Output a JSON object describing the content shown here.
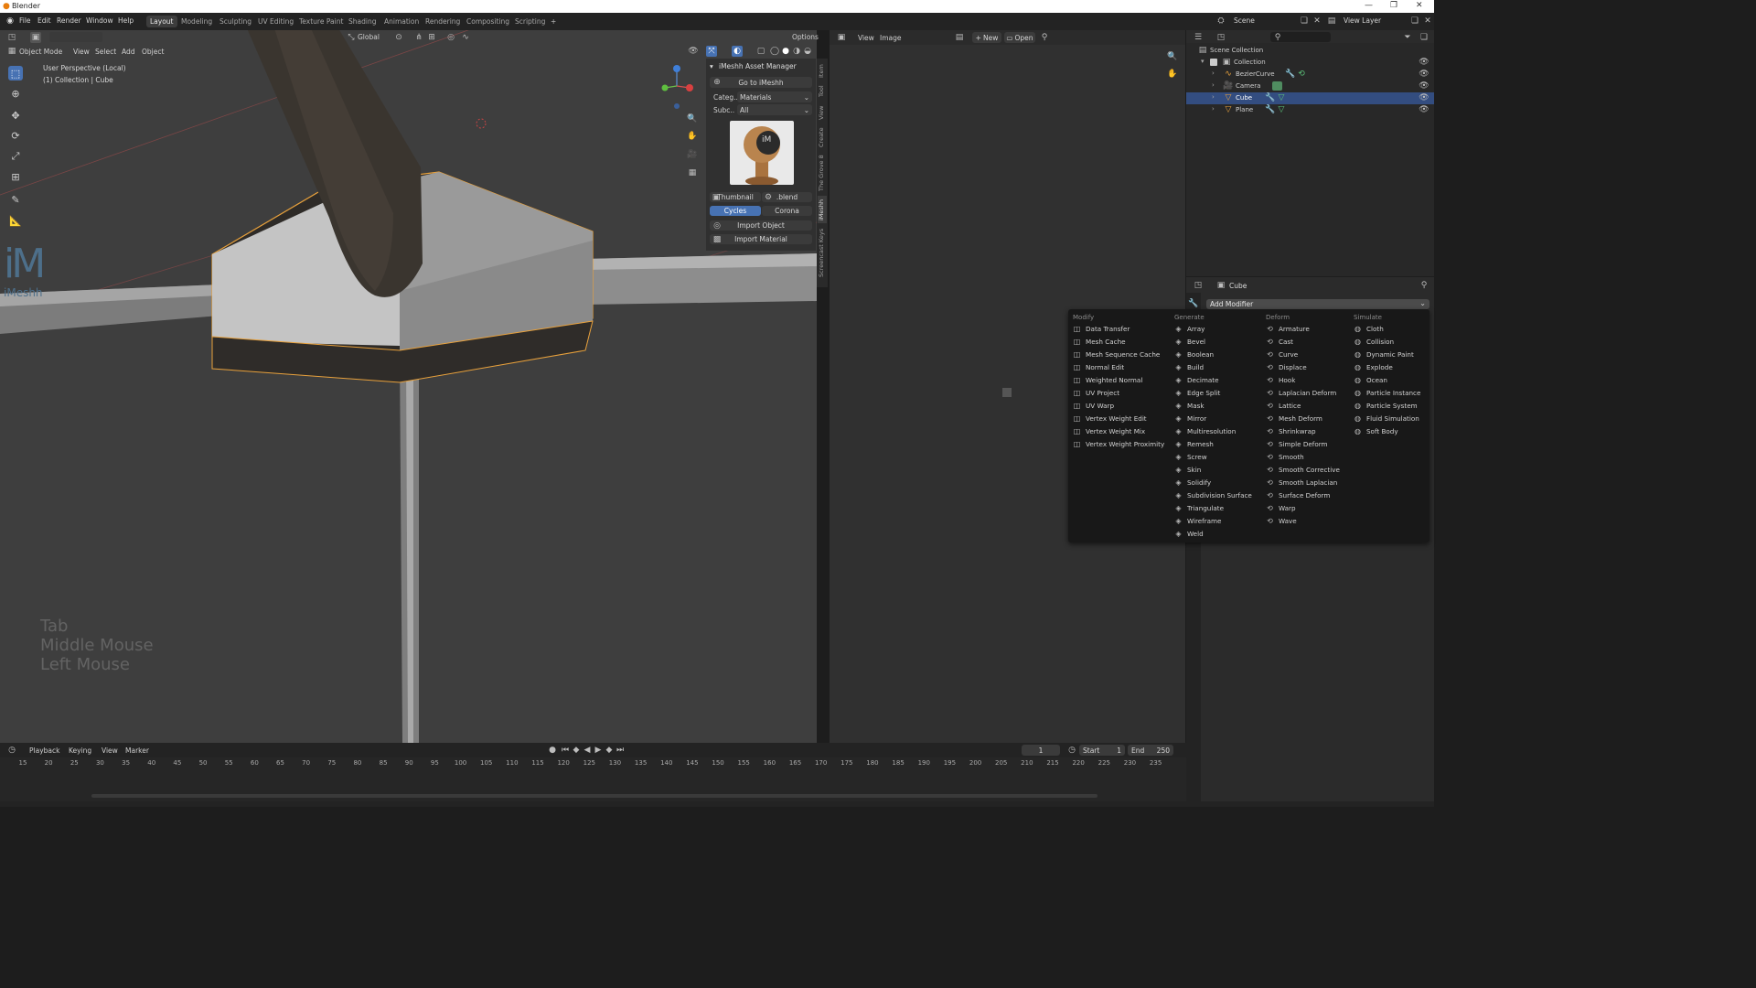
{
  "window": {
    "title": "Blender"
  },
  "menu": [
    "File",
    "Edit",
    "Render",
    "Window",
    "Help"
  ],
  "workspaces": [
    "Layout",
    "Modeling",
    "Sculpting",
    "UV Editing",
    "Texture Paint",
    "Shading",
    "Animation",
    "Rendering",
    "Compositing",
    "Scripting"
  ],
  "active_workspace": "Layout",
  "scene": {
    "name": "Scene",
    "view_layer": "View Layer"
  },
  "viewport": {
    "mode": "Object Mode",
    "menus": [
      "View",
      "Select",
      "Add",
      "Object"
    ],
    "transform_orientation": "Global",
    "options_label": "Options",
    "info_line1": "User Perspective (Local)",
    "info_line2": "(1) Collection | Cube",
    "watermark_text": "iMeshh",
    "key_hints": [
      "Tab",
      "Middle Mouse",
      "Left Mouse"
    ]
  },
  "npanel": {
    "header": "iMeshh Asset Manager",
    "go_button": "Go to iMeshh",
    "category_label": "Categ..",
    "category_value": "Materials",
    "subcategory_label": "Subc..",
    "subcategory_value": "All",
    "thumb_logo": "iM",
    "thumbnail_label": "Thumbnail",
    "blend_label": ".blend",
    "engine_cycles": "Cycles",
    "engine_corona": "Corona",
    "import_object": "Import Object",
    "import_material": "Import Material",
    "tabs": [
      "Item",
      "Tool",
      "View",
      "Create",
      "The Grove 8",
      "iMeshh",
      "Screencast Keys"
    ]
  },
  "image_editor": {
    "menus": [
      "View",
      "Image"
    ],
    "new_label": "New",
    "open_label": "Open"
  },
  "outliner": {
    "root": "Scene Collection",
    "collection": "Collection",
    "items": [
      {
        "label": "BezierCurve",
        "selected": false
      },
      {
        "label": "Camera",
        "selected": false
      },
      {
        "label": "Cube",
        "selected": true
      },
      {
        "label": "Plane",
        "selected": false
      }
    ]
  },
  "properties": {
    "object_name": "Cube",
    "add_modifier": "Add Modifier"
  },
  "modifier_menu": {
    "columns": [
      {
        "header": "Modify",
        "items": [
          "Data Transfer",
          "Mesh Cache",
          "Mesh Sequence Cache",
          "Normal Edit",
          "Weighted Normal",
          "UV Project",
          "UV Warp",
          "Vertex Weight Edit",
          "Vertex Weight Mix",
          "Vertex Weight Proximity"
        ]
      },
      {
        "header": "Generate",
        "items": [
          "Array",
          "Bevel",
          "Boolean",
          "Build",
          "Decimate",
          "Edge Split",
          "Mask",
          "Mirror",
          "Multiresolution",
          "Remesh",
          "Screw",
          "Skin",
          "Solidify",
          "Subdivision Surface",
          "Triangulate",
          "Wireframe",
          "Weld"
        ]
      },
      {
        "header": "Deform",
        "items": [
          "Armature",
          "Cast",
          "Curve",
          "Displace",
          "Hook",
          "Laplacian Deform",
          "Lattice",
          "Mesh Deform",
          "Shrinkwrap",
          "Simple Deform",
          "Smooth",
          "Smooth Corrective",
          "Smooth Laplacian",
          "Surface Deform",
          "Warp",
          "Wave"
        ]
      },
      {
        "header": "Simulate",
        "items": [
          "Cloth",
          "Collision",
          "Dynamic Paint",
          "Explode",
          "Ocean",
          "Particle Instance",
          "Particle System",
          "Fluid Simulation",
          "Soft Body"
        ]
      }
    ]
  },
  "timeline": {
    "menus": [
      "Playback",
      "Keying",
      "View",
      "Marker"
    ],
    "current_frame": "1",
    "start_label": "Start",
    "start_value": "1",
    "end_label": "End",
    "end_value": "250",
    "ruler": [
      "15",
      "20",
      "25",
      "30",
      "35",
      "40",
      "45",
      "50",
      "55",
      "60",
      "65",
      "70",
      "75",
      "80",
      "85",
      "90",
      "95",
      "100",
      "105",
      "110",
      "115",
      "120",
      "125",
      "130",
      "135",
      "140",
      "145",
      "150",
      "155",
      "160",
      "165",
      "170",
      "175",
      "180",
      "185",
      "190",
      "195",
      "200",
      "205",
      "210",
      "215",
      "220",
      "225",
      "230",
      "235"
    ]
  },
  "colors": {
    "accent": "#4772b3",
    "selection_outline": "#e8a13c",
    "outliner_selected": "#334d80"
  }
}
